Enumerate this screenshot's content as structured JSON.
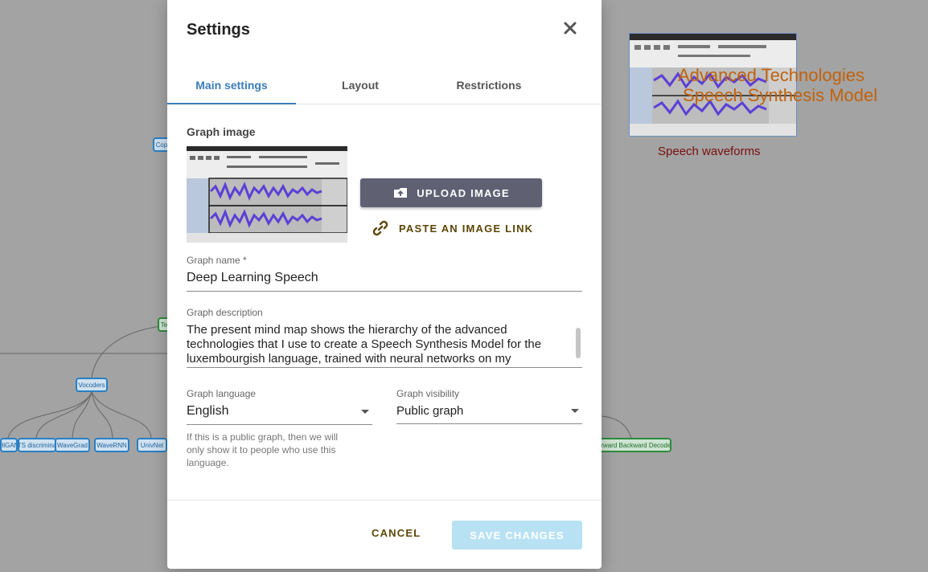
{
  "background": {
    "nodes": [
      {
        "label": "Cop"
      },
      {
        "label": "Te"
      },
      {
        "label": "Vocoders"
      },
      {
        "label": "HiGAN"
      },
      {
        "label": "TS discrimina"
      },
      {
        "label": "WaveGrad"
      },
      {
        "label": "WaveRNN"
      },
      {
        "label": "UnivNet"
      },
      {
        "label": "Forward Backward Decoder"
      }
    ],
    "overlay_title_1": "Advanced Technologies",
    "overlay_title_2": "Speech Synthesis Model",
    "overlay_caption": "Speech waveforms"
  },
  "modal": {
    "title": "Settings",
    "tabs": [
      {
        "label": "Main settings",
        "active": true
      },
      {
        "label": "Layout",
        "active": false
      },
      {
        "label": "Restrictions",
        "active": false
      }
    ],
    "graph_image_label": "Graph image",
    "upload_label": "UPLOAD IMAGE",
    "paste_label": "PASTE AN IMAGE LINK",
    "name_label": "Graph name *",
    "name_value": "Deep Learning Speech",
    "description_label": "Graph description",
    "description_value": "The present mind map shows the hierarchy of the advanced technologies that I use to create a Speech Synthesis Model for the luxembourgish language, trained with neural networks on my",
    "language_label": "Graph language",
    "language_value": "English",
    "visibility_label": "Graph visibility",
    "visibility_value": "Public graph",
    "helper_text": "If this is a public graph, then we will only show it to people who use this language.",
    "cancel_label": "CANCEL",
    "save_label": "SAVE CHANGES"
  },
  "colors": {
    "accent": "#3a7db8",
    "upload_button": "#5f6173",
    "save_button_disabled": "#b8e2f4",
    "text_button": "#5c4606"
  },
  "icons": [
    "close-icon",
    "cloud-upload-icon",
    "link-icon",
    "chevron-down-icon"
  ]
}
